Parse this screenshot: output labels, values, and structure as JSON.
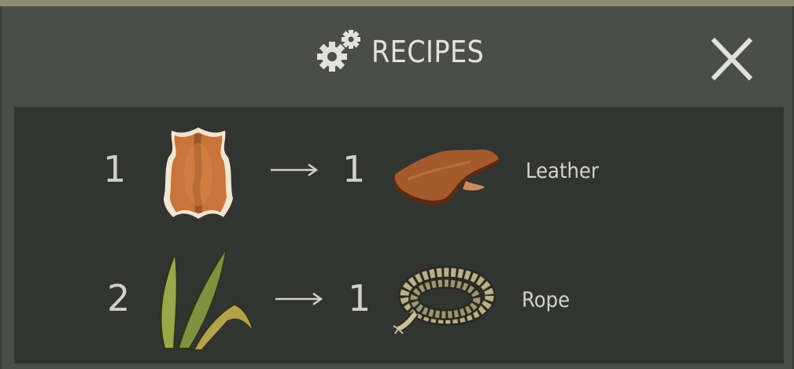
{
  "window": {
    "title": "RECIPES",
    "icons": {
      "title": "gears-icon",
      "close": "close-icon"
    }
  },
  "recipes": [
    {
      "input": {
        "quantity": "1",
        "icon": "animal-hide-icon"
      },
      "output": {
        "quantity": "1",
        "icon": "leather-icon",
        "name": "Leather"
      }
    },
    {
      "input": {
        "quantity": "2",
        "icon": "plant-fiber-icon"
      },
      "output": {
        "quantity": "1",
        "icon": "rope-icon",
        "name": "Rope"
      }
    }
  ],
  "colors": {
    "window_bg": "#4b4d4a",
    "panel_bg": "#323432",
    "text": "#cfd0cc",
    "top_strip": "#8f8a78"
  }
}
